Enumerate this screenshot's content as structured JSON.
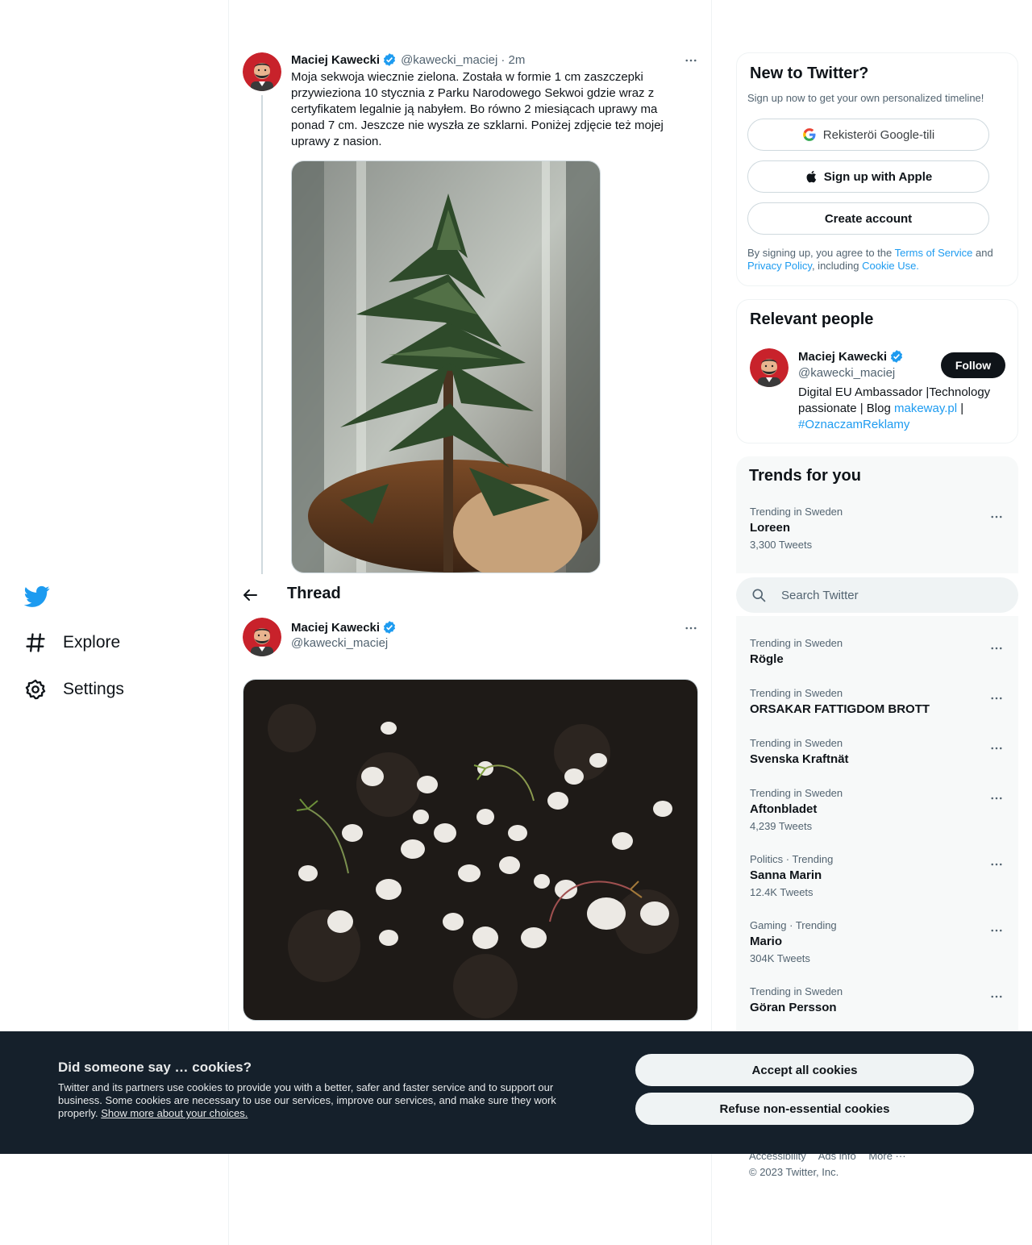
{
  "nav": {
    "explore": "Explore",
    "settings": "Settings"
  },
  "tweet1": {
    "name": "Maciej Kawecki",
    "handle": "@kawecki_maciej",
    "time": "· 2m",
    "text": "Moja sekwoja wiecznie zielona. Została w formie 1 cm zaszczepki przywieziona 10 stycznia z Parku Narodowego Sekwoi gdzie wraz z certyfikatem legalnie ją nabyłem. Bo równo 2 miesiącach uprawy ma ponad 7 cm. Jeszcze nie wyszła ze szklarni. Poniżej zdjęcie też mojej uprawy z nasion."
  },
  "thread": {
    "title": "Thread"
  },
  "tweet2": {
    "name": "Maciej Kawecki",
    "handle": "@kawecki_maciej"
  },
  "signup": {
    "title": "New to Twitter?",
    "subtitle": "Sign up now to get your own personalized timeline!",
    "google": "Rekisteröi Google-tili",
    "apple": "Sign up with Apple",
    "create": "Create account",
    "terms_prefix": "By signing up, you agree to the ",
    "terms": "Terms of Service",
    "and": " and",
    "privacy": "Privacy Policy",
    "including": ", including ",
    "cookie_use": "Cookie Use."
  },
  "relevant": {
    "title": "Relevant people",
    "name": "Maciej Kawecki",
    "handle": "@kawecki_maciej",
    "follow": "Follow",
    "bio_1": "Digital EU Ambassador |Technology passionate | Blog ",
    "bio_link": "makeway.pl",
    "bio_2": " |",
    "bio_hashtag": "#OznaczamReklamy"
  },
  "trends": {
    "title": "Trends for you",
    "first": {
      "ctx": "Trending in Sweden",
      "name": "Loreen",
      "count": "3,300 Tweets"
    },
    "items": [
      {
        "ctx": "Trending in Sweden",
        "name": "Rögle",
        "count": ""
      },
      {
        "ctx": "Trending in Sweden",
        "name": "ORSAKAR FATTIGDOM BROTT",
        "count": ""
      },
      {
        "ctx": "Trending in Sweden",
        "name": "Svenska Kraftnät",
        "count": ""
      },
      {
        "ctx": "Trending in Sweden",
        "name": "Aftonbladet",
        "count": "4,239 Tweets"
      },
      {
        "ctx": "Politics · Trending",
        "name": "Sanna Marin",
        "count": "12.4K Tweets"
      },
      {
        "ctx": "Gaming · Trending",
        "name": "Mario",
        "count": "304K Tweets"
      },
      {
        "ctx": "Trending in Sweden",
        "name": "Göran Persson",
        "count": ""
      }
    ]
  },
  "search": {
    "placeholder": "Search Twitter"
  },
  "footer": {
    "accessibility": "Accessibility",
    "ads": "Ads info",
    "more": "More ···",
    "copyright": "© 2023 Twitter, Inc."
  },
  "cookie": {
    "title": "Did someone say … cookies?",
    "body": "Twitter and its partners use cookies to provide you with a better, safer and faster service and to support our business. Some cookies are necessary to use our services, improve our services, and make sure they work properly. ",
    "link": "Show more about your choices.",
    "accept": "Accept all cookies",
    "refuse": "Refuse non-essential cookies"
  },
  "colors": {
    "accent": "#1d9bf0",
    "text": "#0f1419",
    "muted": "#536471",
    "banner": "#15202b"
  },
  "icons": [
    "twitter-logo-icon",
    "hashtag-icon",
    "gear-icon",
    "verified-badge-icon",
    "more-icon",
    "back-arrow-icon",
    "google-icon",
    "apple-icon",
    "search-icon"
  ]
}
